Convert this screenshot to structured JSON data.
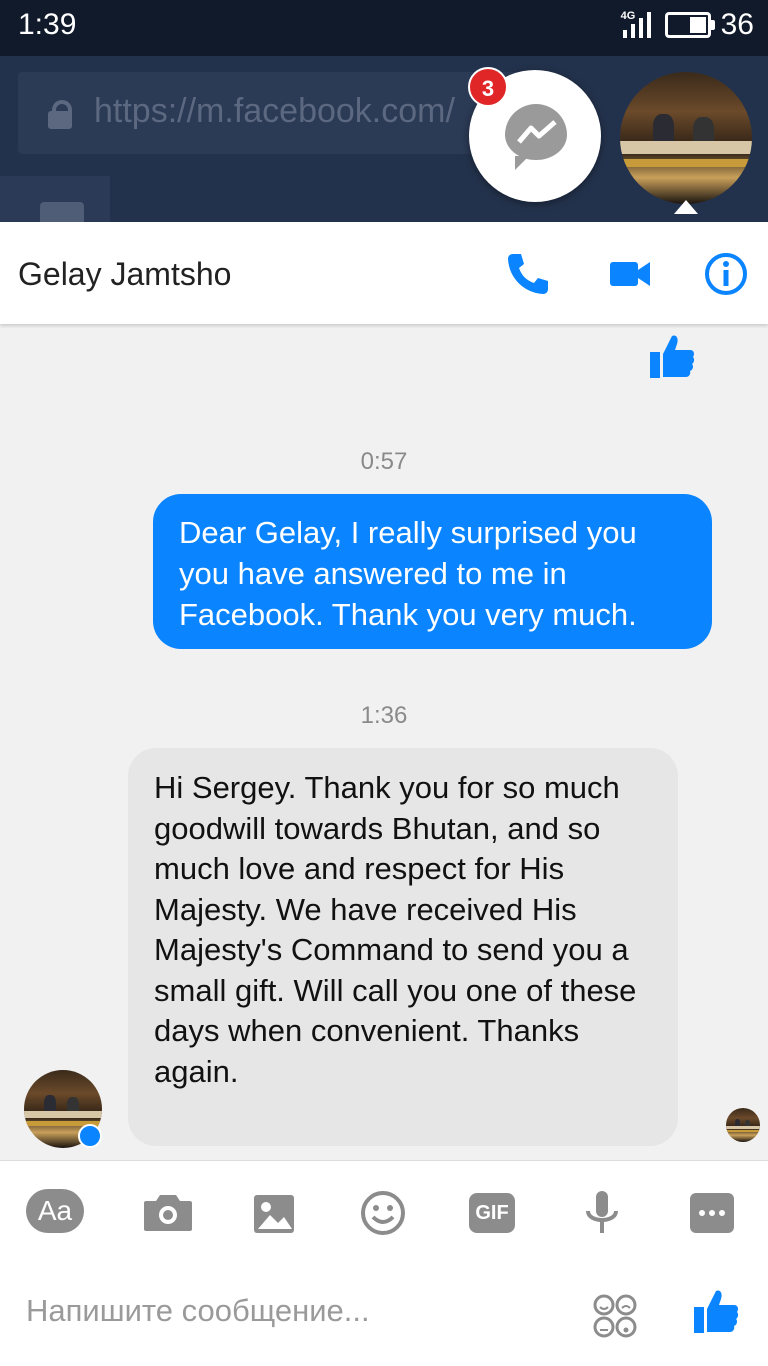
{
  "status_bar": {
    "time": "1:39",
    "network": "4G",
    "battery": "36"
  },
  "browser": {
    "url": "https://m.facebook.com/"
  },
  "chat_heads": {
    "messenger_badge_count": "3"
  },
  "conversation": {
    "contact_name": "Gelay Jamtsho",
    "messages": [
      {
        "type": "timestamp",
        "text": "0:57"
      },
      {
        "type": "outgoing",
        "text": "Dear Gelay, I really surprised you you have answered to me in Facebook. Thank you very much."
      },
      {
        "type": "timestamp",
        "text": "1:36"
      },
      {
        "type": "incoming",
        "text": "Hi Sergey. Thank you for so much goodwill towards Bhutan, and so much love and respect for His Majesty. We have received His Majesty's Command to send you a small gift. Will call you one of these days when convenient. Thanks again."
      }
    ]
  },
  "composer": {
    "aa_label": "Aa",
    "gif_label": "GIF",
    "placeholder": "Напишите сообщение..."
  },
  "colors": {
    "accent": "#0a84ff",
    "tool_gray": "#8c8c8c",
    "incoming_bubble": "#e6e6e6"
  },
  "icons": [
    "phone-icon",
    "video-camera-icon",
    "info-icon",
    "thumbs-up-icon",
    "camera-icon",
    "gallery-icon",
    "emoji-icon",
    "microphone-icon",
    "more-icon",
    "stickers-icon"
  ]
}
